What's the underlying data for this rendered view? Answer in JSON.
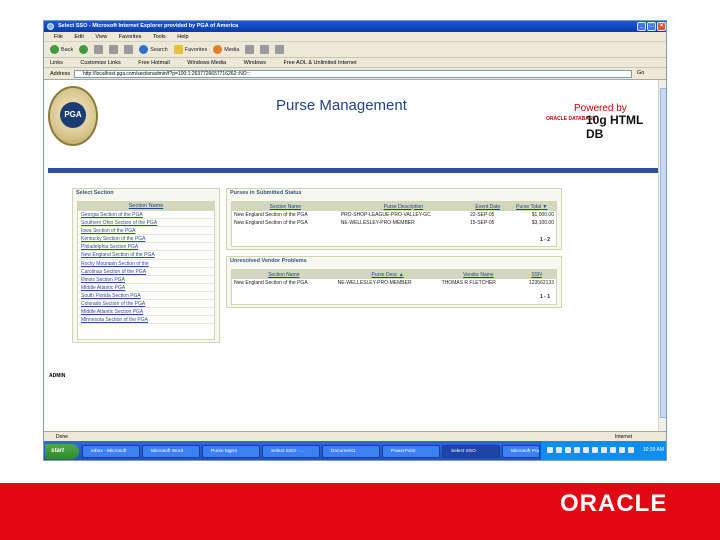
{
  "browser": {
    "title": "Select SSO - Microsoft Internet Explorer provided by PGA of America",
    "menu": [
      "File",
      "Edit",
      "View",
      "Favorites",
      "Tools",
      "Help"
    ],
    "toolbar": [
      "Back",
      "Search",
      "Favorites",
      "Media"
    ],
    "links_label": "Links",
    "links": [
      "Customize Links",
      "Free Hotmail",
      "Windows Media",
      "Windows",
      "Free AOL & Unlimited Internet"
    ],
    "address_label": "Address",
    "address_value": "http://localhost.pga.com/sectionadmin/f?p=100:1:2637726657716262::NO:::",
    "go_label": "Go",
    "status_left": "Done",
    "status_right": "Internet"
  },
  "header": {
    "logo_text": "PGA",
    "title": "Purse Management",
    "powered_by": "Powered by",
    "oracle_small": "ORACLE DATABASE",
    "product": "10g HTML DB"
  },
  "select_section": {
    "title": "Select Section",
    "column": "Section Name",
    "items": [
      "Georgia Section of the PGA",
      "Southern Ohio Section of the PGA",
      "Iowa Section of the PGA",
      "Kentucky Section of the PGA",
      "Philadelphia Section PGA",
      "New England Section of the PGA",
      "Rocky Mountain Section of the",
      "Carolinas Section of the PGA",
      "Illinois Section PGA",
      "Middle Atlantic PGA",
      "South Florida Section PGA",
      "Colorado Section of the PGA",
      "Middle Atlantic Section PGA",
      "Minnesota Section of the PGA"
    ]
  },
  "purses": {
    "title": "Purses in Submitted Status",
    "columns": [
      "Section Name",
      "Purse Description",
      "Event Date",
      "Purse Total"
    ],
    "rows": [
      [
        "New England Section of the PGA",
        "PRO-SHOP-LEAGUE-PRO-VALLEY-GC",
        "22-SEP-05",
        "$1,000.00"
      ],
      [
        "New England Section of the PGA",
        "NE-WELLESLEY-PRO-MEMBER",
        "15-SEP-05",
        "$3,100.00"
      ]
    ],
    "pager": "1 - 2"
  },
  "vendor": {
    "title": "Unresolved Vendor Problems",
    "columns": [
      "Section Name",
      "Purse Desc",
      "Vendor Name",
      "SSN"
    ],
    "rows": [
      [
        "New England Section of the PGA",
        "NE-WELLESLEY-PRO-MEMBER",
        "THOMAS R FLETCHER",
        "123562133"
      ]
    ],
    "pager": "1 - 1"
  },
  "admin_label": "ADMIN",
  "taskbar": {
    "start": "start",
    "tasks": [
      "Inbox - Microsoft",
      "Microsoft Word",
      "Purse Mgmt",
      "Select SSO - ...",
      "Document1",
      "PowerPoint",
      "Select SSO",
      "Microsoft PowerPoint"
    ],
    "clock": "10:39 AM"
  },
  "slide_brand": "ORACLE"
}
